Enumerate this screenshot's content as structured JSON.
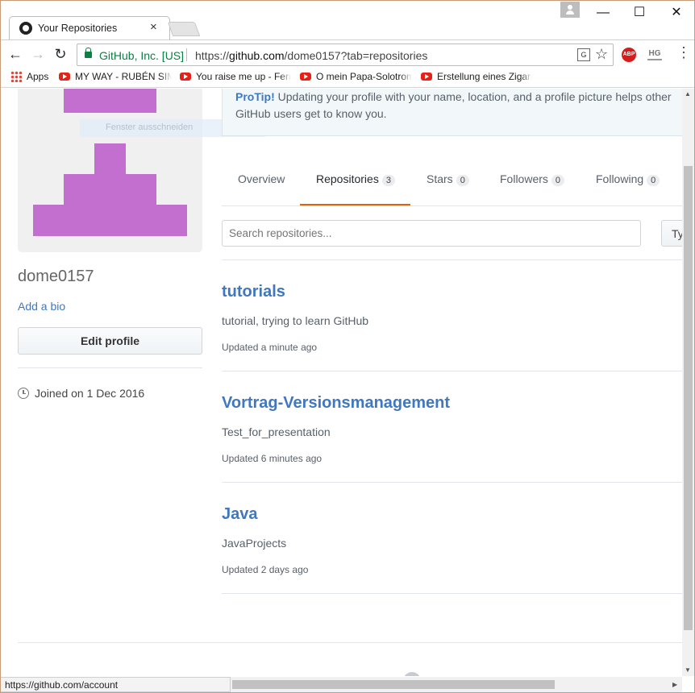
{
  "browser": {
    "tab_title": "Your Repositories",
    "tab_close": "×",
    "site_identity": "GitHub, Inc. [US]",
    "url_prefix": "https://",
    "url_host": "github.com",
    "url_path": "/dome0157?tab=repositories",
    "window_minimize": "—",
    "window_maximize": "☐",
    "window_close": "✕",
    "back": "←",
    "forward": "→",
    "reload": "↻",
    "star": "☆",
    "menu": "⋮",
    "translate_label": "G",
    "abp_label": "ABP",
    "hg_label": "HG",
    "status_url": "https://github.com/account",
    "snip_tooltip": "Fenster ausschneiden"
  },
  "bookmarks": [
    {
      "label": "Apps"
    },
    {
      "label": "MY WAY - RUBÉN SIMÓN"
    },
    {
      "label": "You raise me up - Ferr"
    },
    {
      "label": "O mein Papa-Solotrom"
    },
    {
      "label": "Erstellung eines Zigarr"
    }
  ],
  "profile": {
    "username": "dome0157",
    "add_bio": "Add a bio",
    "edit_profile": "Edit profile",
    "joined": "Joined on 1 Dec 2016",
    "avatar_color": "#c36fcf"
  },
  "protip": {
    "title": "ProTip!",
    "text": " Updating your profile with your name, location, and a profile picture helps other GitHub users get to know you."
  },
  "tabs": [
    {
      "label": "Overview",
      "count": null
    },
    {
      "label": "Repositories",
      "count": "3",
      "selected": true
    },
    {
      "label": "Stars",
      "count": "0"
    },
    {
      "label": "Followers",
      "count": "0"
    },
    {
      "label": "Following",
      "count": "0"
    }
  ],
  "search": {
    "placeholder": "Search repositories...",
    "type_button": "Ty"
  },
  "repos": [
    {
      "name": "tutorials",
      "description": "tutorial, trying to learn GitHub",
      "updated": "Updated a minute ago"
    },
    {
      "name": "Vortrag-Versionsmanagement",
      "description": "Test_for_presentation",
      "updated": "Updated 6 minutes ago"
    },
    {
      "name": "Java",
      "description": "JavaProjects",
      "updated": "Updated 2 days ago"
    }
  ],
  "colors": {
    "link": "#4078c0",
    "selected_tab": "#e36209",
    "secure": "#0b8043"
  }
}
